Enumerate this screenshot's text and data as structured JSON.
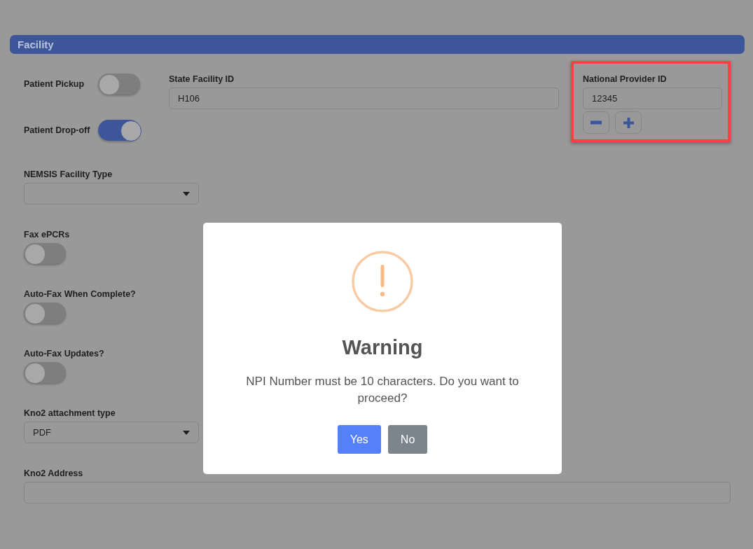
{
  "section": {
    "title": "Facility"
  },
  "top_toggles": [
    {
      "label": "Patient Pickup",
      "on": false
    },
    {
      "label": "Patient Drop-off",
      "on": true
    }
  ],
  "state_facility_id": {
    "label": "State Facility ID",
    "value": "H106"
  },
  "national_provider_id": {
    "label": "National Provider ID",
    "value": "12345",
    "highlighted": true
  },
  "fields": [
    {
      "kind": "select",
      "label": "NEMSIS Facility Type"
    },
    {
      "kind": "toggle",
      "label": "Fax ePCRs",
      "on": false
    },
    {
      "kind": "toggle",
      "label": "Auto-Fax When Complete?",
      "on": false
    },
    {
      "kind": "toggle",
      "label": "Auto-Fax Updates?",
      "on": false
    },
    {
      "kind": "select",
      "label": "Kno2 attachment type",
      "value": "PDF"
    },
    {
      "kind": "input",
      "label": "Kno2 Address"
    }
  ],
  "dialog": {
    "title": "Warning",
    "message": "NPI Number must be 10 characters. Do you want to proceed?",
    "buttons": [
      {
        "label": "Yes",
        "kind": "confirm"
      },
      {
        "label": "No",
        "kind": "cancel"
      }
    ]
  }
}
